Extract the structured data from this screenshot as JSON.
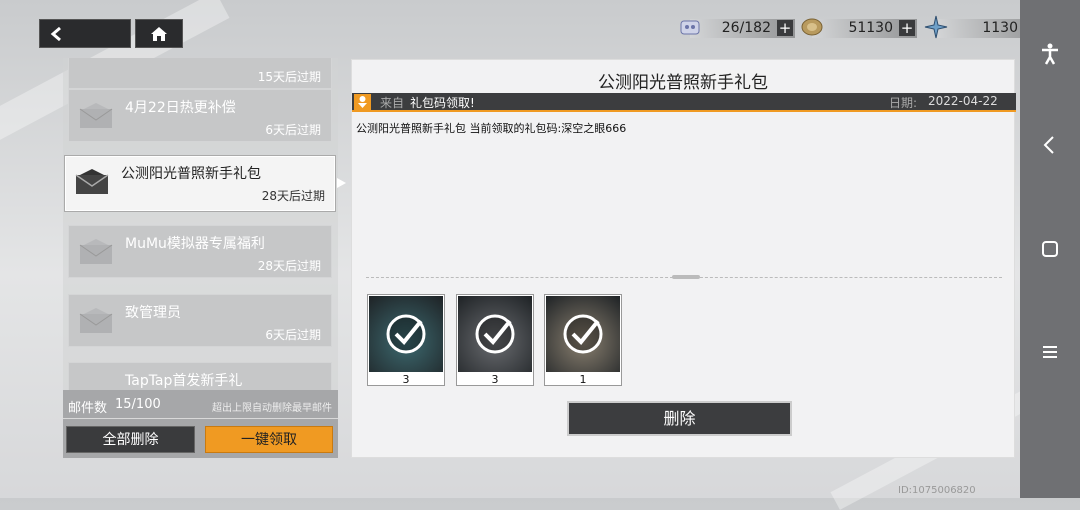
{
  "resources": [
    {
      "name": "stamina-icon",
      "value": "26/182"
    },
    {
      "name": "coin-icon",
      "value": "51130"
    },
    {
      "name": "crystal-icon",
      "value": "1130"
    }
  ],
  "mail_list": [
    {
      "title": "",
      "expires": "15天后过期"
    },
    {
      "title": "4月22日热更补偿",
      "expires": "6天后过期"
    },
    {
      "title": "公测阳光普照新手礼包",
      "expires": "28天后过期"
    },
    {
      "title": "MuMu模拟器专属福利",
      "expires": "28天后过期"
    },
    {
      "title": "致管理员",
      "expires": "6天后过期"
    },
    {
      "title": "TapTap首发新手礼",
      "expires": ""
    }
  ],
  "footer": {
    "count_label": "邮件数",
    "count_value": "15/100",
    "note": "超出上限自动删除最早邮件",
    "delete_all": "全部删除",
    "claim_all": "一键领取"
  },
  "detail": {
    "title": "公测阳光普照新手礼包",
    "from_label": "来自",
    "sender": "礼包码领取!",
    "date_label": "日期:",
    "date": "2022-04-22",
    "body": "公测阳光普照新手礼包 当前领取的礼包码:深空之眼666",
    "rewards": [
      {
        "qty": "3"
      },
      {
        "qty": "3"
      },
      {
        "qty": "1"
      }
    ],
    "delete_label": "删除"
  },
  "uid": "ID:1075006820"
}
